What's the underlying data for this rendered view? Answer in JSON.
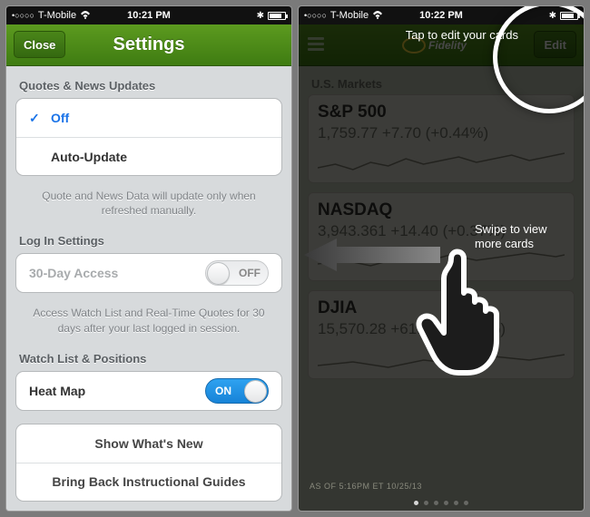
{
  "status": {
    "carrier": "T-Mobile",
    "time1": "10:21 PM",
    "time2": "10:22 PM",
    "signal": "•○○○○"
  },
  "phone1": {
    "nav": {
      "close": "Close",
      "title": "Settings"
    },
    "section1": {
      "header": "Quotes & News Updates",
      "opt_off": "Off",
      "opt_auto": "Auto-Update",
      "footer": "Quote and News Data will update only when refreshed manually."
    },
    "section2": {
      "header": "Log In Settings",
      "row_label": "30-Day Access",
      "switch_text": "OFF",
      "footer": "Access Watch List and Real-Time Quotes for 30 days after your last logged in session."
    },
    "section3": {
      "header": "Watch List & Positions",
      "row_label": "Heat Map",
      "switch_text": "ON"
    },
    "section4": {
      "row1": "Show What's New",
      "row2": "Bring Back Instructional Guides"
    }
  },
  "phone2": {
    "nav": {
      "edit": "Edit"
    },
    "tooltip_edit": "Tap to edit your cards",
    "swipe_text": "Swipe to view more cards",
    "markets_header": "U.S. Markets",
    "asof": "AS OF 5:16PM ET 10/25/13",
    "cards": [
      {
        "name": "S&P 500",
        "price": "1,759.77",
        "change": "+7.70",
        "pct": "(+0.44%)"
      },
      {
        "name": "NASDAQ",
        "price": "3,943.361",
        "change": "+14.40",
        "pct": "(+0.37%)"
      },
      {
        "name": "DJIA",
        "price": "15,570.28",
        "change": "+61.07",
        "pct": "(+0.39%)"
      }
    ]
  }
}
